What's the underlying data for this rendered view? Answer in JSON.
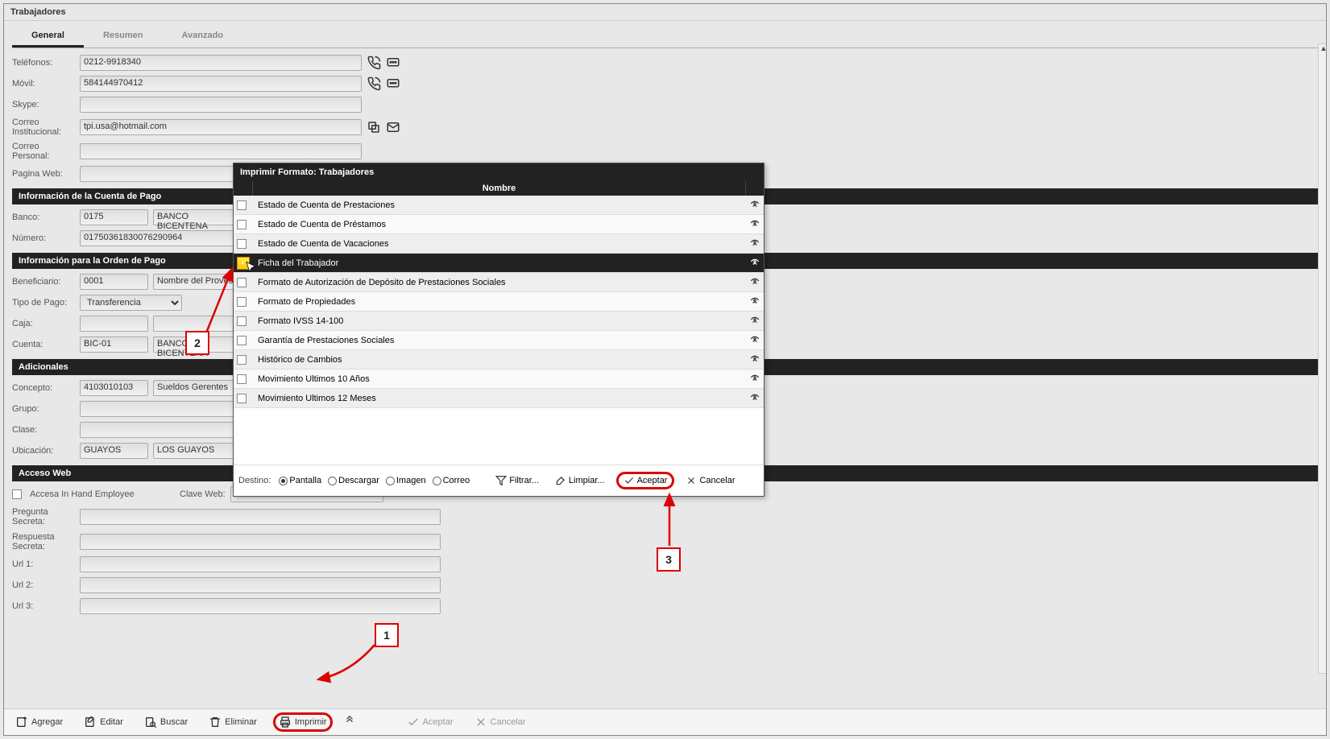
{
  "window_title": "Trabajadores",
  "tabs": [
    "General",
    "Resumen",
    "Avanzado"
  ],
  "fields": {
    "telefonos_lbl": "Teléfonos:",
    "telefonos_val": "0212-9918340",
    "movil_lbl": "Móvil:",
    "movil_val": "584144970412",
    "skype_lbl": "Skype:",
    "skype_val": "",
    "correo_inst_lbl": "Correo Institucional:",
    "correo_inst_val": "tpi.usa@hotmail.com",
    "correo_pers_lbl": "Correo Personal:",
    "pagina_web_lbl": "Pagina Web:"
  },
  "sections": {
    "cuenta_pago": "Información de la Cuenta de Pago",
    "orden_pago": "Información para la Orden de Pago",
    "adicionales": "Adicionales",
    "acceso_web": "Acceso Web"
  },
  "cuenta": {
    "banco_lbl": "Banco:",
    "banco_code": "0175",
    "banco_name": "BANCO BICENTENA",
    "numero_lbl": "Número:",
    "numero_val": "01750361830076290964"
  },
  "orden": {
    "benef_lbl": "Beneficiario:",
    "benef_code": "0001",
    "benef_name": "Nombre del Provee",
    "tipo_lbl": "Tipo de Pago:",
    "tipo_val": "Transferencia",
    "caja_lbl": "Caja:",
    "cuenta_lbl": "Cuenta:",
    "cuenta_code": "BIC-01",
    "cuenta_name": "BANCO BICENTENA"
  },
  "adic": {
    "concepto_lbl": "Concepto:",
    "concepto_code": "4103010103",
    "concepto_name": "Sueldos Gerentes",
    "grupo_lbl": "Grupo:",
    "clase_lbl": "Clase:",
    "ubic_lbl": "Ubicación:",
    "ubic_code": "GUAYOS",
    "ubic_name": "LOS GUAYOS"
  },
  "web": {
    "accesa_lbl": "Accesa In Hand Employee",
    "clave_lbl": "Clave Web:",
    "preg_lbl": "Pregunta Secreta:",
    "resp_lbl": "Respuesta Secreta:",
    "url1_lbl": "Url 1:",
    "url2_lbl": "Url 2:",
    "url3_lbl": "Url 3:"
  },
  "bottombar": {
    "agregar": "Agregar",
    "editar": "Editar",
    "buscar": "Buscar",
    "eliminar": "Eliminar",
    "imprimir": "Imprimir",
    "aceptar": "Aceptar",
    "cancelar": "Cancelar"
  },
  "modal": {
    "title": "Imprimir Formato: Trabajadores",
    "col_name": "Nombre",
    "rows": [
      "Estado de Cuenta de Prestaciones",
      "Estado de Cuenta de Préstamos",
      "Estado de Cuenta de Vacaciones",
      "Ficha del Trabajador",
      "Formato de Autorización de Depósito de Prestaciones Sociales",
      "Formato de Propiedades",
      "Formato IVSS 14-100",
      "Garantía de Prestaciones Sociales",
      "Histórico de Cambios",
      "Movimiento Ultimos 10 Años",
      "Movimiento Ultimos 12 Meses"
    ],
    "selected_index": 3,
    "destino_lbl": "Destino:",
    "radios": [
      "Pantalla",
      "Descargar",
      "Imagen",
      "Correo"
    ],
    "filtrar": "Filtrar...",
    "limpiar": "Limpiar...",
    "aceptar": "Aceptar",
    "cancelar": "Cancelar"
  },
  "callouts": {
    "c1": "1",
    "c2": "2",
    "c3": "3"
  }
}
